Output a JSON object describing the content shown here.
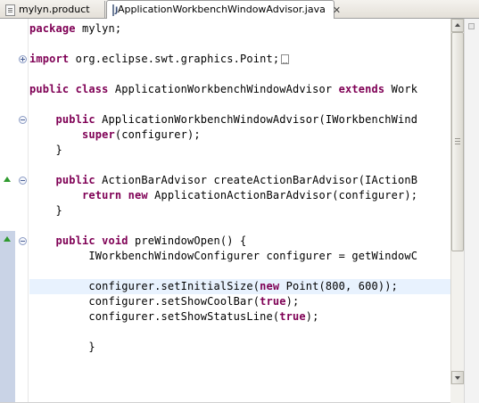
{
  "tabs": [
    {
      "label": "mylyn.product",
      "icon": "product-file-icon",
      "active": false
    },
    {
      "label": "ApplicationWorkbenchWindowAdvisor.java",
      "icon": "java-file-icon",
      "active": true,
      "close": "✕"
    }
  ],
  "editor": {
    "language": "java",
    "keyword_color": "#7f0055",
    "current_line_color": "#e8f2fe",
    "lines": [
      {
        "parts": [
          {
            "t": "package",
            "kw": true
          },
          {
            "t": " mylyn;"
          }
        ]
      },
      {
        "parts": []
      },
      {
        "parts": [
          {
            "t": "import",
            "kw": true
          },
          {
            "t": " org.eclipse.swt.graphics.Point;"
          }
        ],
        "folded": true
      },
      {
        "parts": []
      },
      {
        "parts": [
          {
            "t": "public",
            "kw": true
          },
          {
            "t": " "
          },
          {
            "t": "class",
            "kw": true
          },
          {
            "t": " ApplicationWorkbenchWindowAdvisor "
          },
          {
            "t": "extends",
            "kw": true
          },
          {
            "t": " Work"
          }
        ]
      },
      {
        "parts": []
      },
      {
        "parts": [
          {
            "t": "    "
          },
          {
            "t": "public",
            "kw": true
          },
          {
            "t": " ApplicationWorkbenchWindowAdvisor(IWorkbenchWind"
          }
        ]
      },
      {
        "parts": [
          {
            "t": "        "
          },
          {
            "t": "super",
            "kw": true
          },
          {
            "t": "(configurer);"
          }
        ]
      },
      {
        "parts": [
          {
            "t": "    }"
          }
        ]
      },
      {
        "parts": []
      },
      {
        "parts": [
          {
            "t": "    "
          },
          {
            "t": "public",
            "kw": true
          },
          {
            "t": " ActionBarAdvisor createActionBarAdvisor(IActionB"
          }
        ]
      },
      {
        "parts": [
          {
            "t": "        "
          },
          {
            "t": "return",
            "kw": true
          },
          {
            "t": " "
          },
          {
            "t": "new",
            "kw": true
          },
          {
            "t": " ApplicationActionBarAdvisor(configurer);"
          }
        ]
      },
      {
        "parts": [
          {
            "t": "    }"
          }
        ]
      },
      {
        "parts": []
      },
      {
        "parts": [
          {
            "t": "    "
          },
          {
            "t": "public",
            "kw": true
          },
          {
            "t": " "
          },
          {
            "t": "void",
            "kw": true
          },
          {
            "t": " preWindowOpen() {"
          }
        ]
      },
      {
        "parts": [
          {
            "t": "         IWorkbenchWindowConfigurer configurer = getWindowC"
          }
        ]
      },
      {
        "parts": []
      },
      {
        "parts": [
          {
            "t": "         configurer.setInitialSize("
          },
          {
            "t": "new",
            "kw": true
          },
          {
            "t": " Point(800, 600));"
          }
        ]
      },
      {
        "parts": [
          {
            "t": "         configurer.setShowCoolBar("
          },
          {
            "t": "true",
            "kw": true
          },
          {
            "t": ");"
          }
        ]
      },
      {
        "parts": [
          {
            "t": "         configurer.setShowStatusLine("
          },
          {
            "t": "true",
            "kw": true
          },
          {
            "t": ");"
          }
        ]
      },
      {
        "parts": []
      },
      {
        "parts": [
          {
            "t": "         }"
          }
        ]
      }
    ]
  },
  "gutter": {
    "override_marker_color": "#2f9a2f",
    "ruler_highlight_color": "#c9d3e6"
  },
  "scrollbar": {
    "up_arrow": "scroll-up-icon",
    "down_arrow": "scroll-down-icon"
  }
}
